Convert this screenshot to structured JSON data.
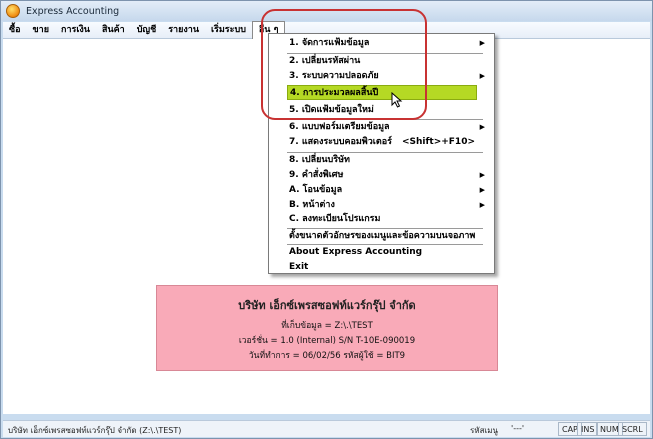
{
  "window": {
    "title": "Express Accounting"
  },
  "menubar": {
    "items": [
      "ซื้อ",
      "ขาย",
      "การเงิน",
      "สินค้า",
      "บัญชี",
      "รายงาน",
      "เริ่มระบบ",
      "อื่น ๆ"
    ]
  },
  "menu": {
    "items": [
      {
        "label": "1. จัดการแฟ้มข้อมูล",
        "submenu": true
      },
      {
        "label": "2. เปลี่ยนรหัสผ่าน"
      },
      {
        "label": "3. ระบบความปลอดภัย",
        "submenu": true
      },
      {
        "label": "4. การประมวลผลสิ้นปี",
        "highlighted": true
      },
      {
        "label": "5. เปิดแฟ้มข้อมูลใหม่"
      },
      {
        "label": "6. แบบฟอร์มเตรียมข้อมูล",
        "submenu": true
      },
      {
        "label": "7. แสดงระบบคอมพิวเตอร์",
        "shortcut": "<Shift>+F10>"
      },
      {
        "label": "8. เปลี่ยนบริษัท"
      },
      {
        "label": "9. คำสั่งพิเศษ",
        "submenu": true
      },
      {
        "label": "A. โอนข้อมูล",
        "submenu": true
      },
      {
        "label": "B. หน้าต่าง",
        "submenu": true
      },
      {
        "label": "C. ลงทะเบียนโปรแกรม"
      },
      {
        "label": "ตั้งขนาดตัวอักษรของเมนูและข้อความบนจอภาพ"
      },
      {
        "label": "About Express Accounting"
      },
      {
        "label": "Exit"
      }
    ]
  },
  "company": {
    "name": "บริษัท เอ็กซ์เพรสซอฟท์แวร์กรุ๊ป จำกัด",
    "data_path": "ที่เก็บข้อมูล = Z:\\.\\TEST",
    "version": "เวอร์ชั่น = 1.0 (Internal)     S/N T-10E-090019",
    "date_user": "วันที่ทำการ  =  06/02/56     รหัสผู้ใช้  =  BIT9"
  },
  "statusbar": {
    "company": "บริษัท เอ็กซ์เพรสซอฟท์แวร์กรุ๊ป จำกัด (Z:\\.\\TEST)",
    "menu_code_label": "รหัสเมนู",
    "menu_code_value": "'---'",
    "indicators": [
      "CAP",
      "INS",
      "NUM",
      "SCRL"
    ]
  },
  "colors": {
    "highlight": "#b5d924",
    "company_box": "#f9aab8",
    "annotation_ring": "#c83232"
  }
}
